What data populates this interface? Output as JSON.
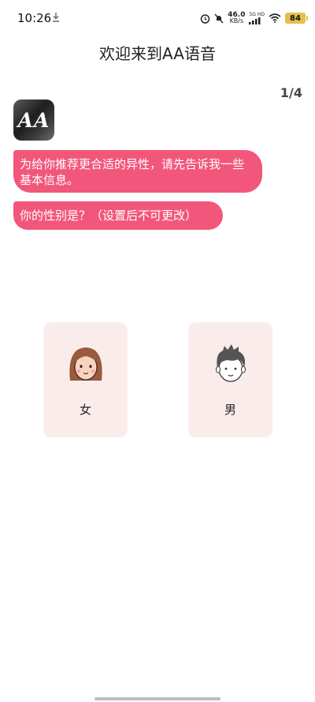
{
  "status_bar": {
    "time": "10:26",
    "net_speed": "46.0",
    "net_unit": "KB/s",
    "net_type_top": "5G HD",
    "battery": "84",
    "icons": [
      "download-icon",
      "alarm-icon",
      "mute-icon",
      "signal-icon",
      "wifi-icon",
      "battery-icon"
    ]
  },
  "header": {
    "title": "欢迎来到AA语音",
    "page_indicator": "1/4"
  },
  "chat": {
    "avatar_text": "AA",
    "messages": [
      "为给你推荐更合适的异性，请先告诉我一些基本信息。",
      "你的性别是？（设置后不可更改）"
    ]
  },
  "gender_options": [
    {
      "label": "女",
      "icon": "female-avatar-icon"
    },
    {
      "label": "男",
      "icon": "male-avatar-icon"
    }
  ],
  "colors": {
    "bubble": "#f2577b",
    "card_bg": "#fbecec",
    "battery": "#e4c04a"
  }
}
